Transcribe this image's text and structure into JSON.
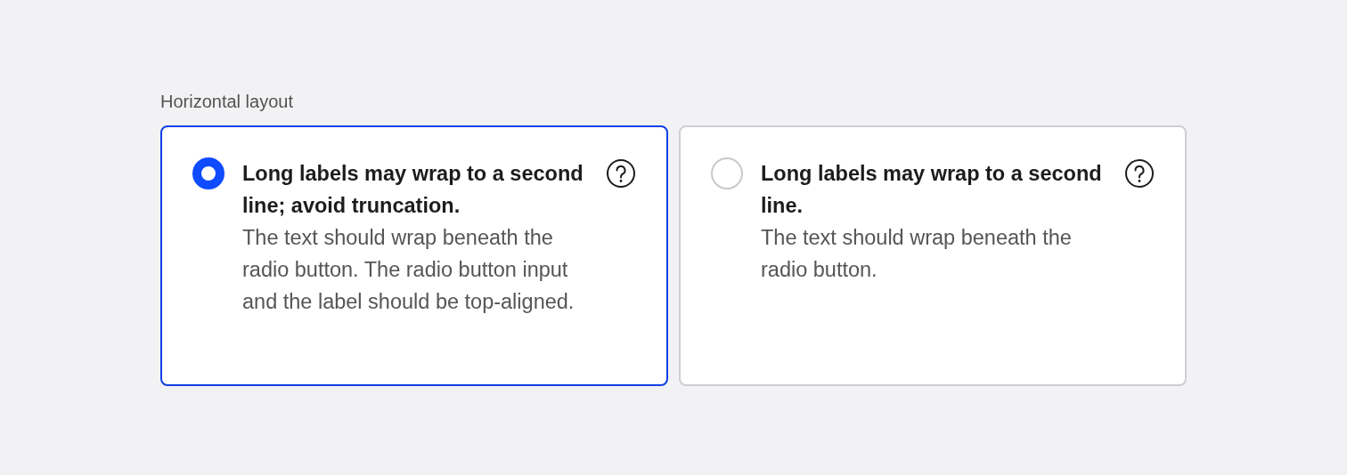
{
  "section_label": "Horizontal layout",
  "options": [
    {
      "title": "Long labels may wrap to a second line; avoid truncation.",
      "description": "The text should wrap beneath the radio button. The radio button input and the label should be top-aligned.",
      "selected": true
    },
    {
      "title": "Long labels may wrap to a second line.",
      "description": "The text should wrap beneath the radio button.",
      "selected": false
    }
  ]
}
